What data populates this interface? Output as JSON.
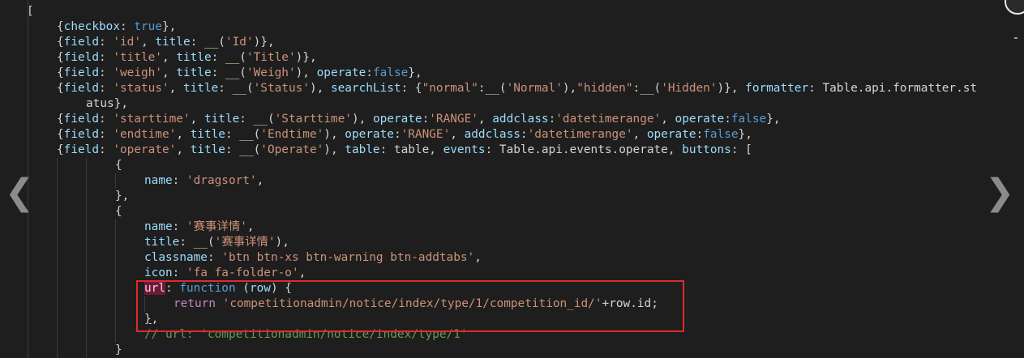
{
  "editor": {
    "lines": [
      [
        [
          "[",
          "p"
        ]
      ],
      [
        [
          "{",
          "p"
        ],
        [
          "checkbox",
          "k"
        ],
        [
          ": ",
          "p"
        ],
        [
          "true",
          "b"
        ],
        [
          "},",
          "p"
        ]
      ],
      [
        [
          "{",
          "p"
        ],
        [
          "field",
          "k"
        ],
        [
          ": ",
          "p"
        ],
        [
          "'id'",
          "s"
        ],
        [
          ", ",
          "p"
        ],
        [
          "title",
          "k"
        ],
        [
          ": ",
          "p"
        ],
        [
          "__",
          "f"
        ],
        [
          "(",
          "p"
        ],
        [
          "'Id'",
          "s"
        ],
        [
          ")},",
          "p"
        ]
      ],
      [
        [
          "{",
          "p"
        ],
        [
          "field",
          "k"
        ],
        [
          ": ",
          "p"
        ],
        [
          "'title'",
          "s"
        ],
        [
          ", ",
          "p"
        ],
        [
          "title",
          "k"
        ],
        [
          ": ",
          "p"
        ],
        [
          "__",
          "f"
        ],
        [
          "(",
          "p"
        ],
        [
          "'Title'",
          "s"
        ],
        [
          ")},",
          "p"
        ]
      ],
      [
        [
          "{",
          "p"
        ],
        [
          "field",
          "k"
        ],
        [
          ": ",
          "p"
        ],
        [
          "'weigh'",
          "s"
        ],
        [
          ", ",
          "p"
        ],
        [
          "title",
          "k"
        ],
        [
          ": ",
          "p"
        ],
        [
          "__",
          "f"
        ],
        [
          "(",
          "p"
        ],
        [
          "'Weigh'",
          "s"
        ],
        [
          "), ",
          "p"
        ],
        [
          "operate",
          "k"
        ],
        [
          ":",
          "p"
        ],
        [
          "false",
          "b"
        ],
        [
          "},",
          "p"
        ]
      ],
      [
        [
          "{",
          "p"
        ],
        [
          "field",
          "k"
        ],
        [
          ": ",
          "p"
        ],
        [
          "'status'",
          "s"
        ],
        [
          ", ",
          "p"
        ],
        [
          "title",
          "k"
        ],
        [
          ": ",
          "p"
        ],
        [
          "__",
          "f"
        ],
        [
          "(",
          "p"
        ],
        [
          "'Status'",
          "s"
        ],
        [
          "), ",
          "p"
        ],
        [
          "searchList",
          "k"
        ],
        [
          ": {",
          "p"
        ],
        [
          "\"normal\"",
          "s"
        ],
        [
          ":",
          "p"
        ],
        [
          "__",
          "f"
        ],
        [
          "(",
          "p"
        ],
        [
          "'Normal'",
          "s"
        ],
        [
          "),",
          "p"
        ],
        [
          "\"hidden\"",
          "s"
        ],
        [
          ":",
          "p"
        ],
        [
          "__",
          "f"
        ],
        [
          "(",
          "p"
        ],
        [
          "'Hidden'",
          "s"
        ],
        [
          ")}, ",
          "p"
        ],
        [
          "formatter",
          "k"
        ],
        [
          ": Table.api.formatter.st",
          "p"
        ]
      ],
      [
        [
          "atus},",
          "p"
        ]
      ],
      [
        [
          "{",
          "p"
        ],
        [
          "field",
          "k"
        ],
        [
          ": ",
          "p"
        ],
        [
          "'starttime'",
          "s"
        ],
        [
          ", ",
          "p"
        ],
        [
          "title",
          "k"
        ],
        [
          ": ",
          "p"
        ],
        [
          "__",
          "f"
        ],
        [
          "(",
          "p"
        ],
        [
          "'Starttime'",
          "s"
        ],
        [
          "), ",
          "p"
        ],
        [
          "operate",
          "k"
        ],
        [
          ":",
          "p"
        ],
        [
          "'RANGE'",
          "s"
        ],
        [
          ", ",
          "p"
        ],
        [
          "addclass",
          "k"
        ],
        [
          ":",
          "p"
        ],
        [
          "'datetimerange'",
          "s"
        ],
        [
          ", ",
          "p"
        ],
        [
          "operate",
          "k"
        ],
        [
          ":",
          "p"
        ],
        [
          "false",
          "b"
        ],
        [
          "},",
          "p"
        ]
      ],
      [
        [
          "{",
          "p"
        ],
        [
          "field",
          "k"
        ],
        [
          ": ",
          "p"
        ],
        [
          "'endtime'",
          "s"
        ],
        [
          ", ",
          "p"
        ],
        [
          "title",
          "k"
        ],
        [
          ": ",
          "p"
        ],
        [
          "__",
          "f"
        ],
        [
          "(",
          "p"
        ],
        [
          "'Endtime'",
          "s"
        ],
        [
          "), ",
          "p"
        ],
        [
          "operate",
          "k"
        ],
        [
          ":",
          "p"
        ],
        [
          "'RANGE'",
          "s"
        ],
        [
          ", ",
          "p"
        ],
        [
          "addclass",
          "k"
        ],
        [
          ":",
          "p"
        ],
        [
          "'datetimerange'",
          "s"
        ],
        [
          ", ",
          "p"
        ],
        [
          "operate",
          "k"
        ],
        [
          ":",
          "p"
        ],
        [
          "false",
          "b"
        ],
        [
          "},",
          "p"
        ]
      ],
      [
        [
          "{",
          "p"
        ],
        [
          "field",
          "k"
        ],
        [
          ": ",
          "p"
        ],
        [
          "'operate'",
          "s"
        ],
        [
          ", ",
          "p"
        ],
        [
          "title",
          "k"
        ],
        [
          ": ",
          "p"
        ],
        [
          "__",
          "f"
        ],
        [
          "(",
          "p"
        ],
        [
          "'Operate'",
          "s"
        ],
        [
          "), ",
          "p"
        ],
        [
          "table",
          "k"
        ],
        [
          ": table, ",
          "p"
        ],
        [
          "events",
          "k"
        ],
        [
          ": Table.api.events.operate, ",
          "p"
        ],
        [
          "buttons",
          "k"
        ],
        [
          ": [",
          "p"
        ]
      ],
      [
        [
          "{",
          "p"
        ]
      ],
      [
        [
          "name",
          "k"
        ],
        [
          ": ",
          "p"
        ],
        [
          "'dragsort'",
          "s"
        ],
        [
          ",",
          "p"
        ]
      ],
      [
        [
          "},",
          "p"
        ]
      ],
      [
        [
          "{",
          "p"
        ]
      ],
      [
        [
          "name",
          "k"
        ],
        [
          ": ",
          "p"
        ],
        [
          "'赛事详情'",
          "s"
        ],
        [
          ",",
          "p"
        ]
      ],
      [
        [
          "title",
          "k"
        ],
        [
          ": ",
          "p"
        ],
        [
          "__",
          "f"
        ],
        [
          "(",
          "p"
        ],
        [
          "'赛事详情'",
          "s"
        ],
        [
          "),",
          "p"
        ]
      ],
      [
        [
          "classname",
          "k"
        ],
        [
          ": ",
          "p"
        ],
        [
          "'btn btn-xs btn-warning btn-addtabs'",
          "s"
        ],
        [
          ",",
          "p"
        ]
      ],
      [
        [
          "icon",
          "k"
        ],
        [
          ": ",
          "p"
        ],
        [
          "'fa fa-folder-o'",
          "s"
        ],
        [
          ",",
          "p"
        ]
      ],
      [
        [
          "url",
          "hl"
        ],
        [
          ": ",
          "p"
        ],
        [
          "function",
          "b"
        ],
        [
          " (",
          "p"
        ],
        [
          "row",
          "k"
        ],
        [
          ") {",
          "p"
        ]
      ],
      [
        [
          "return",
          "x"
        ],
        [
          " ",
          "p"
        ],
        [
          "'competitionadmin/notice/index/type/1/competition_id/'",
          "s"
        ],
        [
          "+",
          "p"
        ],
        [
          "row",
          "p"
        ],
        [
          ".",
          "p"
        ],
        [
          "id",
          "p"
        ],
        [
          ";",
          "p"
        ]
      ],
      [
        [
          "}",
          "u"
        ],
        [
          ",",
          "p"
        ]
      ],
      [
        [
          "// url: 'competitionadmin/notice/index/type/1'",
          "c"
        ]
      ],
      [
        [
          "}",
          "p"
        ]
      ]
    ],
    "prev_icon_glyph": "❮",
    "next_icon_glyph": "❯"
  }
}
